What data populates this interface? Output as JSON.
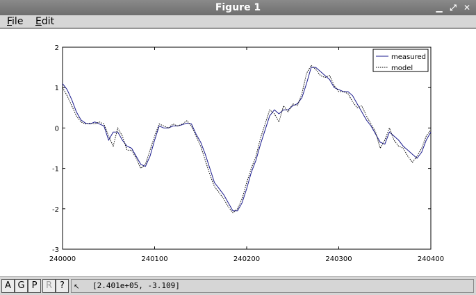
{
  "window": {
    "title": "Figure 1",
    "buttons": [
      "minimize-icon",
      "maximize-icon",
      "close-icon"
    ]
  },
  "menu": {
    "file": {
      "underline": "F",
      "rest": "ile"
    },
    "edit": {
      "underline": "E",
      "rest": "dit"
    }
  },
  "toolbar": {
    "buttons": [
      {
        "label": "A",
        "enabled": true
      },
      {
        "label": "G",
        "enabled": true
      },
      {
        "label": "P",
        "enabled": true
      },
      {
        "label": "R",
        "enabled": false
      },
      {
        "label": "?",
        "enabled": true
      }
    ],
    "coordinates": "[2.401e+05, -3.109]"
  },
  "chart_data": {
    "type": "line",
    "xlim": [
      240000,
      240400
    ],
    "ylim": [
      -3,
      2
    ],
    "xticks": [
      "240000",
      "240100",
      "240200",
      "240300",
      "240400"
    ],
    "yticks": [
      "2",
      "1",
      "0",
      "-1",
      "-2",
      "-3"
    ],
    "legend_position": "top-right",
    "colors": {
      "measured": "#1a1a8c",
      "model": "#000000"
    },
    "series": [
      {
        "name": "measured",
        "style": "solid",
        "x": [
          240000,
          240005,
          240010,
          240015,
          240020,
          240025,
          240030,
          240035,
          240040,
          240045,
          240050,
          240055,
          240060,
          240065,
          240070,
          240075,
          240080,
          240085,
          240090,
          240095,
          240100,
          240105,
          240110,
          240115,
          240120,
          240125,
          240130,
          240135,
          240140,
          240145,
          240150,
          240155,
          240160,
          240165,
          240170,
          240175,
          240180,
          240185,
          240190,
          240195,
          240200,
          240205,
          240210,
          240215,
          240220,
          240225,
          240230,
          240235,
          240240,
          240245,
          240250,
          240255,
          240260,
          240265,
          240270,
          240275,
          240280,
          240285,
          240290,
          240295,
          240300,
          240305,
          240310,
          240315,
          240320,
          240325,
          240330,
          240335,
          240340,
          240345,
          240350,
          240355,
          240360,
          240365,
          240370,
          240375,
          240380,
          240385,
          240390,
          240395,
          240400
        ],
        "y": [
          1.1,
          0.95,
          0.7,
          0.4,
          0.2,
          0.12,
          0.1,
          0.15,
          0.1,
          0.05,
          -0.3,
          -0.1,
          -0.1,
          -0.3,
          -0.45,
          -0.5,
          -0.7,
          -0.9,
          -0.95,
          -0.7,
          -0.3,
          0.05,
          0.0,
          0.0,
          0.05,
          0.05,
          0.08,
          0.12,
          0.1,
          -0.15,
          -0.35,
          -0.65,
          -1.0,
          -1.35,
          -1.5,
          -1.65,
          -1.85,
          -2.05,
          -2.05,
          -1.85,
          -1.5,
          -1.1,
          -0.8,
          -0.4,
          -0.05,
          0.3,
          0.45,
          0.35,
          0.45,
          0.45,
          0.55,
          0.6,
          0.75,
          1.1,
          1.5,
          1.5,
          1.4,
          1.3,
          1.2,
          1.0,
          0.95,
          0.9,
          0.9,
          0.8,
          0.6,
          0.4,
          0.2,
          0.05,
          -0.15,
          -0.35,
          -0.4,
          -0.1,
          -0.2,
          -0.3,
          -0.45,
          -0.55,
          -0.65,
          -0.75,
          -0.6,
          -0.3,
          -0.1
        ]
      },
      {
        "name": "model",
        "style": "dotted",
        "x": [
          240000,
          240005,
          240010,
          240015,
          240020,
          240025,
          240030,
          240035,
          240040,
          240045,
          240050,
          240055,
          240060,
          240065,
          240070,
          240075,
          240080,
          240085,
          240090,
          240095,
          240100,
          240105,
          240110,
          240115,
          240120,
          240125,
          240130,
          240135,
          240140,
          240145,
          240150,
          240155,
          240160,
          240165,
          240170,
          240175,
          240180,
          240185,
          240190,
          240195,
          240200,
          240205,
          240210,
          240215,
          240220,
          240225,
          240230,
          240235,
          240240,
          240245,
          240250,
          240255,
          240260,
          240265,
          240270,
          240275,
          240280,
          240285,
          240290,
          240295,
          240300,
          240305,
          240310,
          240315,
          240320,
          240325,
          240330,
          240335,
          240340,
          240345,
          240350,
          240355,
          240360,
          240365,
          240370,
          240375,
          240380,
          240385,
          240390,
          240395,
          240400
        ],
        "y": [
          1.0,
          0.8,
          0.55,
          0.3,
          0.15,
          0.1,
          0.12,
          0.1,
          0.15,
          0.1,
          -0.2,
          -0.45,
          0.0,
          -0.2,
          -0.55,
          -0.55,
          -0.75,
          -1.0,
          -0.9,
          -0.55,
          -0.2,
          0.1,
          0.05,
          0.0,
          0.1,
          0.05,
          0.1,
          0.18,
          0.05,
          -0.2,
          -0.45,
          -0.8,
          -1.15,
          -1.45,
          -1.6,
          -1.75,
          -1.95,
          -2.1,
          -2.0,
          -1.75,
          -1.35,
          -1.0,
          -0.7,
          -0.25,
          0.1,
          0.45,
          0.35,
          0.15,
          0.55,
          0.4,
          0.6,
          0.55,
          0.85,
          1.35,
          1.55,
          1.45,
          1.3,
          1.25,
          1.3,
          1.05,
          0.9,
          0.9,
          0.85,
          0.65,
          0.5,
          0.55,
          0.3,
          0.1,
          -0.1,
          -0.5,
          -0.3,
          0.0,
          -0.3,
          -0.45,
          -0.5,
          -0.7,
          -0.85,
          -0.7,
          -0.5,
          -0.2,
          -0.05
        ]
      }
    ]
  }
}
